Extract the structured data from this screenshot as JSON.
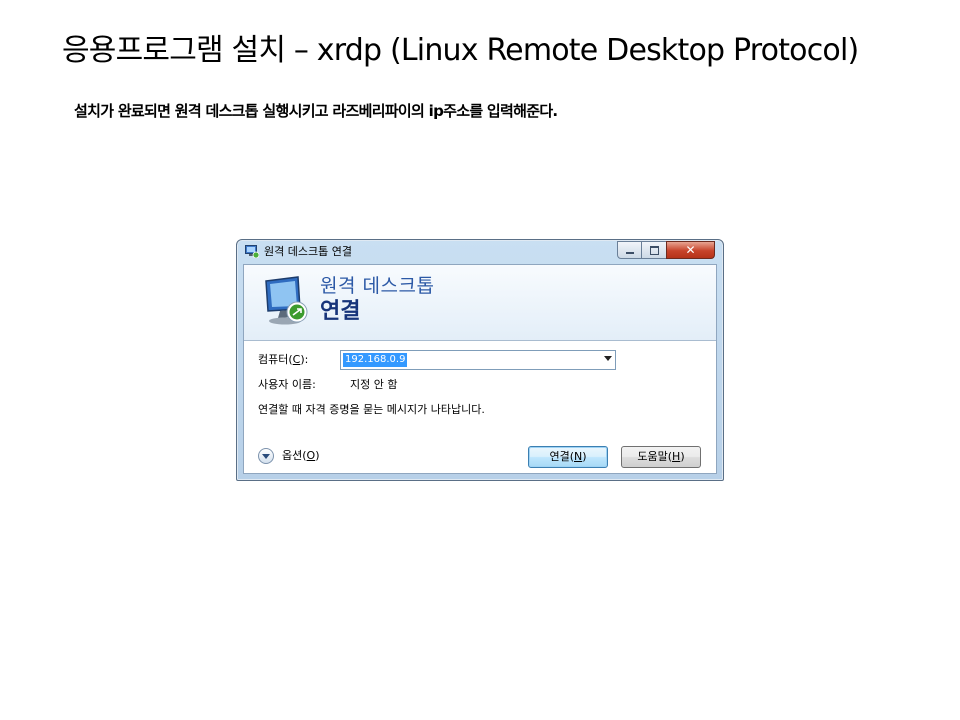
{
  "slide": {
    "title": "응용프로그램 설치 – xrdp (Linux Remote Desktop Protocol)",
    "subtitle": "설치가 완료되면 원격 데스크톱 실행시키고 라즈베리파이의 ip주소를 입력해준다."
  },
  "window": {
    "title": "원격 데스크톱 연결",
    "close_glyph": "✕",
    "banner": {
      "line1": "원격 데스크톱",
      "line2": "연결"
    },
    "computer_label": {
      "prefix": "컴퓨터(",
      "mnemonic": "C",
      "suffix": "):"
    },
    "computer_value": "192.168.0.9",
    "user_label": "사용자 이름:",
    "user_value": "지정 안 함",
    "note": "연결할 때 자격 증명을 묻는 메시지가 나타납니다.",
    "options": {
      "prefix": "옵션(",
      "mnemonic": "O",
      "suffix": ")"
    },
    "connect_button": {
      "prefix": "연결(",
      "mnemonic": "N",
      "suffix": ")"
    },
    "help_button": {
      "prefix": "도움말(",
      "mnemonic": "H",
      "suffix": ")"
    }
  },
  "colors": {
    "banner_line1": "#2c59a6",
    "banner_line2": "#17347a",
    "selection": "#3399ff",
    "close_button": "#c7432a"
  },
  "icons": [
    "remote-desktop-icon",
    "remote-desktop-monitor-icon",
    "options-chevron-icon",
    "dropdown-arrow-icon"
  ]
}
